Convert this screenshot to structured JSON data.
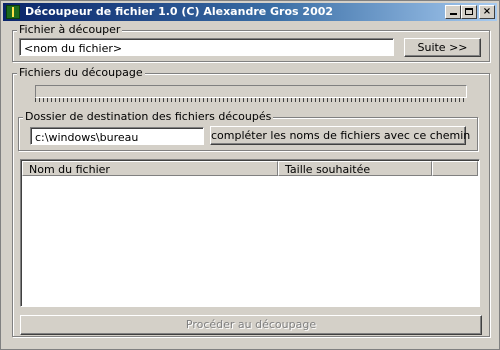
{
  "window": {
    "title": "Découpeur de fichier 1.0 (C) Alexandre Gros 2002",
    "controls": {
      "minimize": "minimize",
      "maximize": "maximize",
      "close": "×"
    }
  },
  "file_group": {
    "label": "Fichier à découper",
    "file_input_value": "<nom du fichier>",
    "next_button": "Suite >>"
  },
  "split_group": {
    "label": "Fichiers du découpage",
    "progress_fraction": 0
  },
  "destination_group": {
    "label": "Dossier de destination des fichiers découpés",
    "folder_value": "c:\\windows\\bureau",
    "complete_button": "compléter les noms de fichiers avec ce chemin"
  },
  "file_list": {
    "columns": [
      "Nom du fichier",
      "Taille souhaitée",
      ""
    ]
  },
  "action_button": "Procéder au découpage",
  "colors": {
    "title_start": "#0a246a",
    "title_end": "#a6caf0",
    "face": "#d4d0c8"
  }
}
